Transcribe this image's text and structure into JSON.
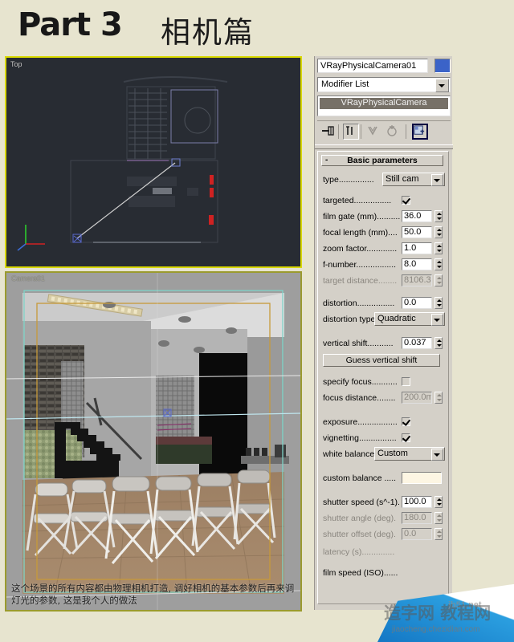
{
  "title": {
    "main": "Part 3",
    "chinese": "相机篇"
  },
  "viewports": {
    "top": {
      "label": "Top"
    },
    "camera": {
      "label": "Camera01",
      "caption": "这个场景的所有内容都由物理相机打造, 调好相机的基本参数后再来调灯光的参数, 这是我个人的做法"
    }
  },
  "panel": {
    "object_name": "VRayPhysicalCamera01",
    "object_color": "#3b63c8",
    "modifier_list_label": "Modifier List",
    "stack_item": "VRayPhysicalCamera",
    "stack_tools": [
      {
        "name": "pin-stack-icon"
      },
      {
        "name": "show-end-result-icon"
      },
      {
        "name": "make-unique-icon"
      },
      {
        "name": "remove-modifier-icon"
      },
      {
        "name": "configure-modifier-sets-icon"
      }
    ],
    "rollout": {
      "collapse_glyph": "-",
      "title": "Basic parameters",
      "params": [
        {
          "label": "type...............",
          "kind": "combo",
          "value": "Still cam",
          "dim": false
        },
        {
          "label": "targeted................",
          "kind": "check",
          "value": "on",
          "dim": false
        },
        {
          "label": "film gate (mm)..........",
          "kind": "spinner",
          "value": "36.0",
          "dim": false
        },
        {
          "label": "focal length (mm)....",
          "kind": "spinner",
          "value": "50.0",
          "dim": false
        },
        {
          "label": "zoom factor.............",
          "kind": "spinner",
          "value": "1.0",
          "dim": false
        },
        {
          "label": "f-number.................",
          "kind": "spinner",
          "value": "8.0",
          "dim": false
        },
        {
          "label": "target distance........",
          "kind": "spinner",
          "value": "8106.3(",
          "dim": true
        },
        {
          "label": "distortion................",
          "kind": "spinner",
          "value": "0.0",
          "dim": false
        },
        {
          "label": "distortion type.",
          "kind": "combo",
          "value": "Quadratic",
          "dim": false
        },
        {
          "label": "vertical shift...........",
          "kind": "spinner",
          "value": "0.037",
          "dim": false
        },
        {
          "label": "Guess vertical shift",
          "kind": "button",
          "value": "",
          "dim": false
        },
        {
          "label": "specify focus...........",
          "kind": "check",
          "value": "off",
          "dim": false
        },
        {
          "label": "focus distance........",
          "kind": "spinner",
          "value": "200.0m",
          "dim": true
        },
        {
          "label": "exposure.................",
          "kind": "check",
          "value": "on",
          "dim": false
        },
        {
          "label": "vignetting................",
          "kind": "check",
          "value": "on",
          "dim": false
        },
        {
          "label": "white balance",
          "kind": "combo",
          "value": "Custom",
          "dim": false
        },
        {
          "label": "custom balance .....",
          "kind": "swatch",
          "value": "#fdf6e3",
          "dim": false
        },
        {
          "label": "shutter speed (s^-1).",
          "kind": "spinner",
          "value": "100.0",
          "dim": false
        },
        {
          "label": "shutter angle (deg).",
          "kind": "spinner",
          "value": "180.0",
          "dim": true
        },
        {
          "label": "shutter offset (deg).",
          "kind": "spinner",
          "value": "0.0",
          "dim": true
        },
        {
          "label": "latency (s)..............",
          "kind": "none",
          "value": "",
          "dim": true
        },
        {
          "label": "film speed (ISO)......",
          "kind": "none",
          "value": "",
          "dim": false
        }
      ]
    }
  },
  "watermark": {
    "chinese": "造字网 教程网",
    "english": "jiaocheng.chezidian.com",
    "site": "jb51.net"
  }
}
